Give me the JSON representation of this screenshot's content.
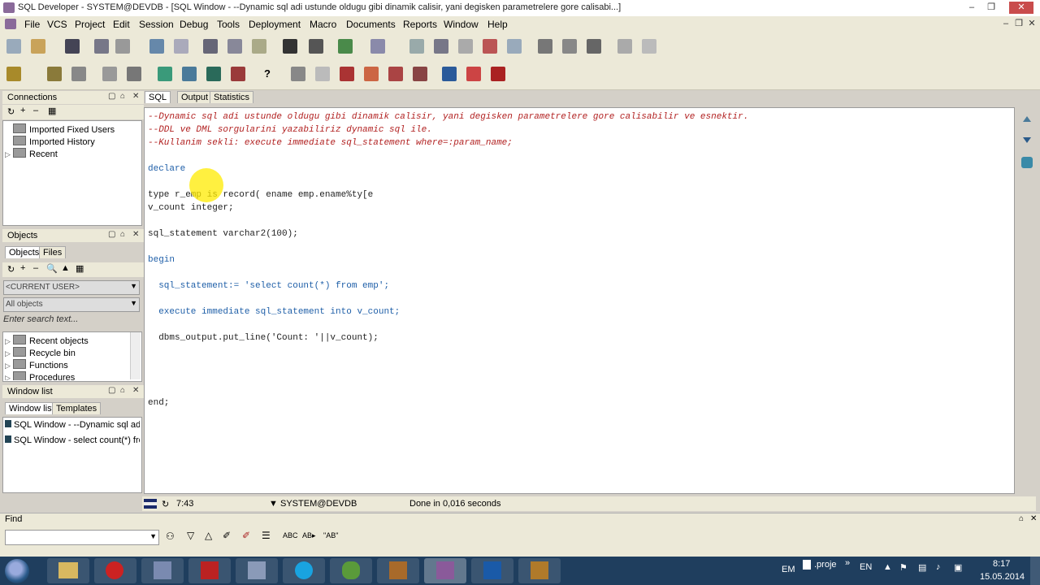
{
  "title": "SQL Developer - SYSTEM@DEVDB - [SQL Window - --Dynamic sql adi ustunde oldugu gibi dinamik calisir, yani degisken parametrelere gore calisabi...]",
  "menu": [
    "File",
    "VCS",
    "Project",
    "Edit",
    "Session",
    "Debug",
    "Tools",
    "Deployment",
    "Macro",
    "Documents",
    "Reports",
    "Window",
    "Help"
  ],
  "connections": {
    "title": "Connections",
    "items": [
      "Imported Fixed Users",
      "Imported History",
      "Recent"
    ]
  },
  "objects": {
    "title": "Objects",
    "tabs": [
      "Objects",
      "Files"
    ],
    "user": "<CURRENT USER>",
    "filter": "All objects",
    "search_placeholder": "Enter search text...",
    "items": [
      "Recent objects",
      "Recycle bin",
      "Functions",
      "Procedures"
    ]
  },
  "window_list": {
    "title": "Window list",
    "tabs": [
      "Window list",
      "Templates"
    ],
    "items": [
      "SQL Window - --Dynamic sql adi us",
      "SQL Window - select count(*) from"
    ]
  },
  "editor_tabs": [
    "SQL",
    "Output",
    "Statistics"
  ],
  "code": [
    {
      "t": "--Dynamic sql adi ustunde oldugu gibi dinamik calisir, yani degisken parametrelere gore calisabilir ve esnektir.",
      "c": "cm"
    },
    {
      "t": "--DDL ve DML sorgularini yazabiliriz dynamic sql ile.",
      "c": "cm"
    },
    {
      "t": "--Kullanim sekli: execute immediate sql_statement where=:param_name;",
      "c": "cm"
    },
    {
      "t": "",
      "c": "pl"
    },
    {
      "t": "declare",
      "c": "kw"
    },
    {
      "t": "",
      "c": "pl"
    },
    {
      "t": "type r_emp is record( ename emp.ename%ty[e",
      "c": "pl"
    },
    {
      "t": "v_count integer;",
      "c": "pl"
    },
    {
      "t": "",
      "c": "pl"
    },
    {
      "t": "sql_statement varchar2(100);",
      "c": "pl"
    },
    {
      "t": "",
      "c": "pl"
    },
    {
      "t": "begin",
      "c": "kw"
    },
    {
      "t": "",
      "c": "pl"
    },
    {
      "t": "  sql_statement:= 'select count(*) from emp';",
      "c": "str"
    },
    {
      "t": "",
      "c": "pl"
    },
    {
      "t": "  execute immediate sql_statement into v_count;",
      "c": "str"
    },
    {
      "t": "",
      "c": "pl"
    },
    {
      "t": "  dbms_output.put_line('Count: '||v_count);",
      "c": "pl"
    },
    {
      "t": "",
      "c": "pl"
    },
    {
      "t": "",
      "c": "pl"
    },
    {
      "t": "",
      "c": "pl"
    },
    {
      "t": "",
      "c": "pl"
    },
    {
      "t": "end;",
      "c": "pl"
    }
  ],
  "status": {
    "position": "7:43",
    "connection": "SYSTEM@DEVDB",
    "message": "Done in 0,016 seconds"
  },
  "find": {
    "label": "Find"
  },
  "taskbar": {
    "lang1": "EM",
    "doc": ".proje",
    "lang2": "EN",
    "time": "8:17",
    "date": "15.05.2014"
  }
}
